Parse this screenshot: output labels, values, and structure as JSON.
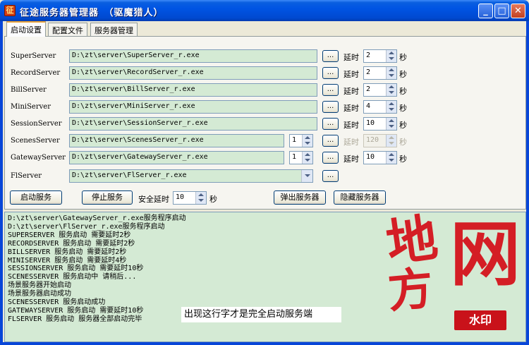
{
  "window": {
    "title": "征途服务器管理器　（驱魔猎人）",
    "icon": "app-icon",
    "controls": {
      "minimize": "_",
      "maximize": "□",
      "close": "✕"
    }
  },
  "tabs": [
    {
      "label": "启动设置",
      "active": true
    },
    {
      "label": "配置文件",
      "active": false
    },
    {
      "label": "服务器管理",
      "active": false
    }
  ],
  "delay_label": "延时",
  "seconds_label": "秒",
  "browse_label": "...",
  "servers": [
    {
      "name": "SuperServer",
      "path": "D:\\zt\\server\\SuperServer_r.exe",
      "delay": "2"
    },
    {
      "name": "RecordServer",
      "path": "D:\\zt\\server\\RecordServer_r.exe",
      "delay": "2"
    },
    {
      "name": "BillServer",
      "path": "D:\\zt\\server\\BillServer_r.exe",
      "delay": "2"
    },
    {
      "name": "MiniServer",
      "path": "D:\\zt\\server\\MiniServer_r.exe",
      "delay": "4"
    },
    {
      "name": "SessionServer",
      "path": "D:\\zt\\server\\SessionServer_r.exe",
      "delay": "10"
    },
    {
      "name": "ScenesServer",
      "path": "D:\\zt\\server\\ScenesServer_r.exe",
      "count": "1",
      "delay": "120",
      "disabled_delay": true
    },
    {
      "name": "GatewayServer",
      "path": "D:\\zt\\server\\GatewayServer_r.exe",
      "count": "1",
      "delay": "10"
    },
    {
      "name": "FlServer",
      "path": "D:\\zt\\server\\FlServer_r.exe",
      "combo": true
    }
  ],
  "actions": {
    "start": "启动服务",
    "stop": "停止服务",
    "safe_delay_label": "安全延时",
    "safe_delay_value": "10",
    "safe_delay_unit": "秒",
    "popup": "弹出服务器",
    "hide": "隐藏服务器"
  },
  "log_lines": [
    "D:\\zt\\server\\GatewayServer_r.exe服务程序启动",
    "D:\\zt\\server\\FlServer_r.exe服务程序启动",
    "SUPERSERVER 服务启动 需要延时2秒",
    "RECORDSERVER 服务启动 需要延时2秒",
    "BILLSERVER 服务启动 需要延时2秒",
    "MINISERVER 服务启动 需要延时4秒",
    "SESSIONSERVER 服务启动 需要延时10秒",
    "SCENESSERVER 服务启动中 请稍后...",
    "场景服务器开始启动",
    "场景服务器启动成功",
    "SCENESSERVER 服务启动成功",
    "GATEWAYSERVER 服务启动 需要延时10秒",
    "FLSERVER 服务启动 服务器全部启动完毕"
  ],
  "annotation": "出现这行字才是完全启动服务端",
  "watermark": {
    "chars": [
      "地",
      "方",
      "网"
    ],
    "badge": "水印",
    "color": "#d4141c"
  }
}
